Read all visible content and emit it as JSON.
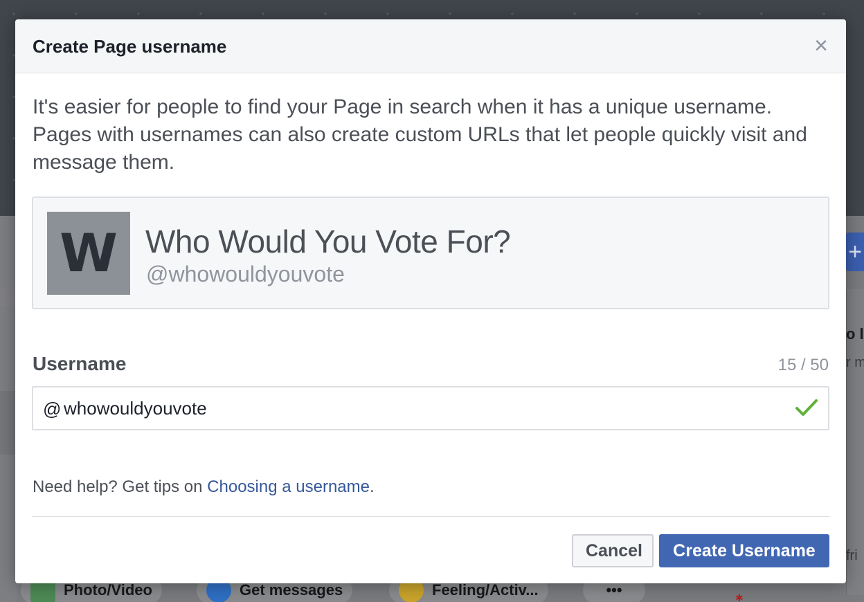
{
  "background": {
    "right_heading_fragment": "o li",
    "right_sub_fragment": "r m",
    "right_input_fragment": "fri",
    "composer_actions": [
      {
        "label": "Photo/Video",
        "icon": "photo-icon"
      },
      {
        "label": "Get messages",
        "icon": "messenger-icon"
      },
      {
        "label": "Feeling/Activ...",
        "icon": "emoji-icon"
      },
      {
        "label": "•••",
        "icon": "more-icon"
      }
    ],
    "add_button_label": "+"
  },
  "dialog": {
    "title": "Create Page username",
    "close_label": "×",
    "intro": "It's easier for people to find your Page in search when it has a unique username. Pages with usernames can also create custom URLs that let people quickly visit and message them.",
    "preview": {
      "avatar_letter": "W",
      "page_name": "Who Would You Vote For?",
      "handle": "@whowouldyouvote"
    },
    "username": {
      "label": "Username",
      "count": "15 / 50",
      "prefix": "@",
      "value": "whowouldyouvote",
      "status_icon": "checkmark-icon"
    },
    "help": {
      "prefix": "Need help? Get tips on ",
      "link": "Choosing a username",
      "suffix": "."
    },
    "buttons": {
      "cancel": "Cancel",
      "create": "Create Username"
    }
  },
  "colors": {
    "primary": "#4267b2",
    "link": "#365899",
    "valid": "#42b72a"
  }
}
